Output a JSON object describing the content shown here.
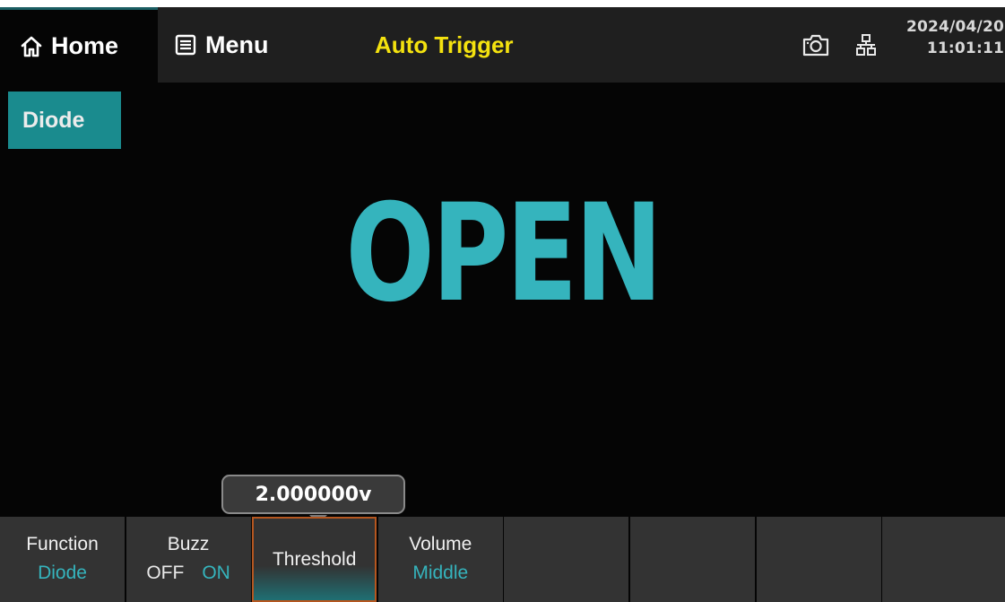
{
  "topbar": {
    "home_label": "Home",
    "menu_label": "Menu",
    "trigger_mode": "Auto Trigger",
    "date": "2024/04/20",
    "time": "11:01:11",
    "icons": [
      "home-icon",
      "menu-icon",
      "camera-icon",
      "lan-icon"
    ]
  },
  "function_badge": "Diode",
  "reading": "OPEN",
  "threshold_tooltip": "2.000000v",
  "softkeys": [
    {
      "title": "Function",
      "value": "Diode"
    },
    {
      "title": "Buzz",
      "value_off": "OFF",
      "value_on": "ON"
    },
    {
      "title": "Threshold"
    },
    {
      "title": "Volume",
      "value": "Middle"
    }
  ],
  "colors": {
    "accent": "#35b4bd",
    "badge_bg": "#1a8b8e",
    "trigger_text": "#f4e20f",
    "selected_border": "#b5561f",
    "softkey_bg": "#333333"
  }
}
